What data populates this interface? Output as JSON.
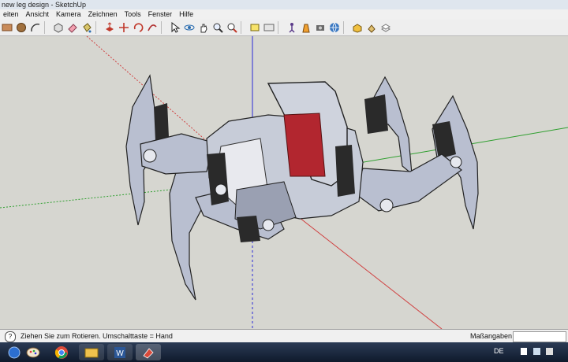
{
  "window": {
    "title": "new leg design - SketchUp"
  },
  "menu": [
    "eiten",
    "Ansicht",
    "Kamera",
    "Zeichnen",
    "Tools",
    "Fenster",
    "Hilfe"
  ],
  "toolbar": {
    "tools": [
      "rectangle-icon",
      "circle-icon",
      "arc-icon",
      "make-component-icon",
      "eraser-icon",
      "paint-bucket-icon",
      "push-pull-icon",
      "move-icon",
      "rotate-icon",
      "follow-me-icon",
      "select-icon",
      "orbit-icon",
      "pan-icon",
      "zoom-icon",
      "zoom-extents-icon",
      "section-plane-icon",
      "tape-measure-icon",
      "walk-icon",
      "look-around-icon",
      "position-camera-icon",
      "get-models-icon",
      "share-model-icon",
      "components-icon",
      "layers-icon"
    ]
  },
  "status": {
    "message": "Ziehen Sie zum Rotieren.  Umschalttaste = Hand",
    "measurements_label": "Maßangaben",
    "measurements_value": ""
  },
  "taskbar": {
    "language": "DE",
    "apps": [
      "start-icon",
      "paint-icon",
      "chrome-icon",
      "explorer-icon",
      "word-icon",
      "sketchup-icon"
    ]
  }
}
